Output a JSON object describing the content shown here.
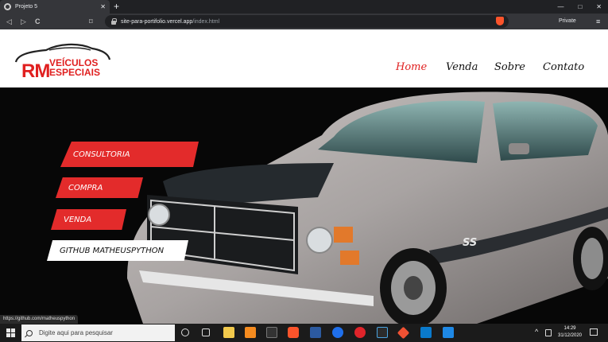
{
  "browser": {
    "tab_title": "Projeto 5",
    "tab_close": "✕",
    "new_tab": "+",
    "url_host": "site-para-portifolio.vercel.app",
    "url_path": "/index.html",
    "private_label": "Private",
    "back": "◁",
    "forward": "▷",
    "reload": "C",
    "bookmark": "⌑",
    "menu": "≡",
    "win_min": "—",
    "win_max": "□",
    "win_close": "✕",
    "status_link": "https://github.com/matheuspython"
  },
  "site": {
    "logo": {
      "initials": "RM",
      "line1": "VEÍCULOS",
      "line2": "ESPECIAIS",
      "brand_color": "#e02020"
    },
    "nav": [
      {
        "label": "Home",
        "active": true
      },
      {
        "label": "Venda",
        "active": false
      },
      {
        "label": "Sobre",
        "active": false
      },
      {
        "label": "Contato",
        "active": false
      }
    ],
    "nav_active_color": "#e02020",
    "hero_buttons": [
      {
        "label": "CONSULTORIA",
        "style": "red"
      },
      {
        "label": "COMPRA",
        "style": "red"
      },
      {
        "label": "VENDA",
        "style": "red"
      },
      {
        "label": "GITHUB MATHEUSPYTHON",
        "style": "white"
      }
    ],
    "car_badge": "SS"
  },
  "taskbar": {
    "search_placeholder": "Digite aqui para pesquisar",
    "time": "14:29",
    "date": "31/12/2020",
    "tray_up": "^",
    "icons": [
      "cortana-icon",
      "task-view-icon",
      "file-explorer-icon",
      "sublime-icon",
      "terminal-icon",
      "brave-icon",
      "powershell-icon",
      "app-icon",
      "opera-icon",
      "console-icon",
      "git-icon",
      "vscode-icon",
      "media-icon"
    ]
  }
}
